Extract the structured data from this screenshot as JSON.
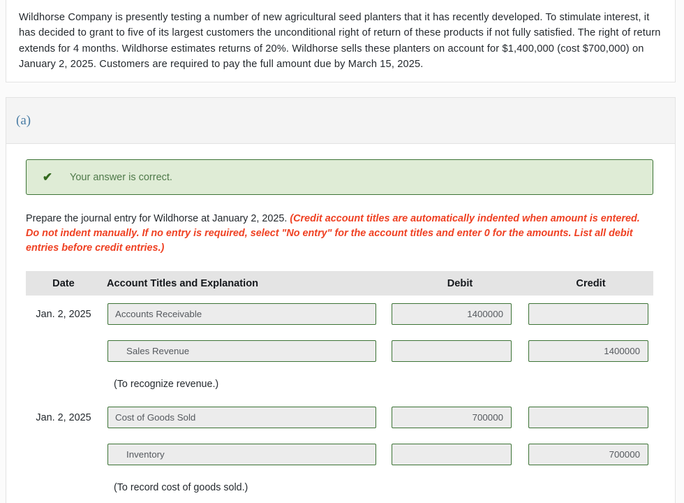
{
  "problem": {
    "text": "Wildhorse Company is presently testing a number of new agricultural seed planters that it has recently developed. To stimulate interest, it has decided to grant to five of its largest customers the unconditional right of return of these products if not fully satisfied. The right of return extends for 4 months. Wildhorse estimates returns of 20%. Wildhorse sells these planters on account for $1,400,000 (cost $700,000) on January 2, 2025. Customers are required to pay the full amount due by March 15, 2025."
  },
  "part": {
    "label": "(a)"
  },
  "banner": {
    "icon": "check-icon",
    "text": "Your answer is correct.",
    "bg_color": "#dfecd6",
    "border_color": "#3c7335",
    "text_color": "#4f7a4a"
  },
  "instructions": {
    "lead": "Prepare the journal entry for Wildhorse at January 2, 2025. ",
    "emphasis": "(Credit account titles are automatically indented when amount is entered. Do not indent manually. If no entry is required, select \"No entry\" for the account titles and enter 0 for the amounts. List all debit entries before credit entries.)",
    "emphasis_color": "#ef4123"
  },
  "journal": {
    "headers": {
      "date": "Date",
      "account": "Account Titles and Explanation",
      "debit": "Debit",
      "credit": "Credit"
    },
    "rows": [
      {
        "type": "entry",
        "date": "Jan. 2, 2025",
        "account": "Accounts Receivable",
        "indented": false,
        "debit": "1400000",
        "credit": ""
      },
      {
        "type": "entry",
        "date": "",
        "account": "Sales Revenue",
        "indented": true,
        "debit": "",
        "credit": "1400000"
      },
      {
        "type": "memo",
        "text": "(To recognize revenue.)"
      },
      {
        "type": "entry",
        "date": "Jan. 2, 2025",
        "account": "Cost of Goods Sold",
        "indented": false,
        "debit": "700000",
        "credit": ""
      },
      {
        "type": "entry",
        "date": "",
        "account": "Inventory",
        "indented": true,
        "debit": "",
        "credit": "700000"
      },
      {
        "type": "memo",
        "text": "(To record cost of goods sold.)"
      }
    ]
  }
}
